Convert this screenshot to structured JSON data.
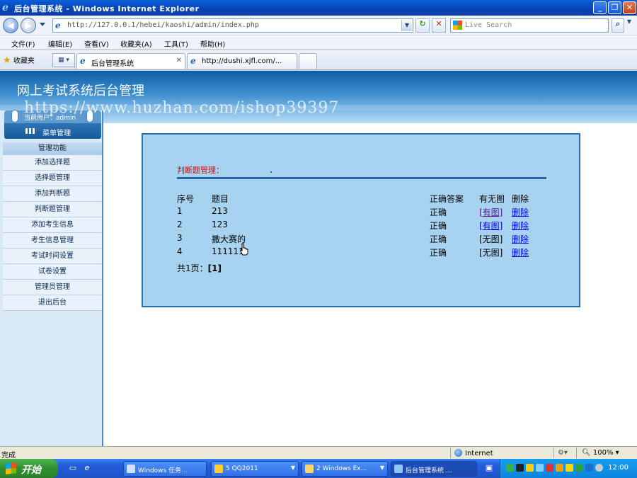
{
  "window": {
    "title": "后台管理系统 - Windows Internet Explorer",
    "min_glyph": "_",
    "max_glyph": "❐",
    "close_glyph": "✕"
  },
  "addressbar": {
    "url": "http://127.0.0.1/hebei/kaoshi/admin/index.php",
    "search_placeholder": "Live Search"
  },
  "menu": [
    "文件(F)",
    "编辑(E)",
    "查看(V)",
    "收藏夹(A)",
    "工具(T)",
    "帮助(H)"
  ],
  "tabs": {
    "favorites_label": "收藏夹",
    "items": [
      {
        "label": "后台管理系统",
        "close": "✕"
      },
      {
        "label": "http://dushi.xjfl.com/..."
      }
    ]
  },
  "page": {
    "system_title": "网上考试系统后台管理",
    "watermark": "https://www.huzhan.com/ishop39397",
    "user_label": "当前用户：admin",
    "menu_header": "菜单管理",
    "functions_header": "管理功能",
    "sidebar_items": [
      "添加选择题",
      "选择题管理",
      "添加判断题",
      "判断题管理",
      "添加考生信息",
      "考生信息管理",
      "考试时间设置",
      "试卷设置",
      "管理员管理",
      "退出后台"
    ],
    "panel": {
      "title": "判断题管理：",
      "columns": [
        "序号",
        "题目",
        "正确答案",
        "有无图",
        "删除"
      ],
      "rows": [
        {
          "id": "1",
          "question": "213",
          "answer": "正确",
          "image": "[有图]",
          "delete": "删除"
        },
        {
          "id": "2",
          "question": "123",
          "answer": "正确",
          "image": "[有图]",
          "delete": "删除"
        },
        {
          "id": "3",
          "question": "撒大赛的",
          "answer": "正确",
          "image": "[无图]",
          "delete": "删除"
        },
        {
          "id": "4",
          "question": "111111",
          "answer": "正确",
          "image": "[无图]",
          "delete": "删除"
        }
      ],
      "pager_prefix": "共1页：",
      "pager_current": "[1]"
    }
  },
  "statusbar": {
    "status": "完成",
    "zone": "Internet",
    "zoom": "100%"
  },
  "taskbar": {
    "start": "开始",
    "tasks": [
      "Windows 任务...",
      "5 QQ2011",
      "2 Windows Ex...",
      "后台管理系统 ..."
    ],
    "clock": "12:00"
  }
}
